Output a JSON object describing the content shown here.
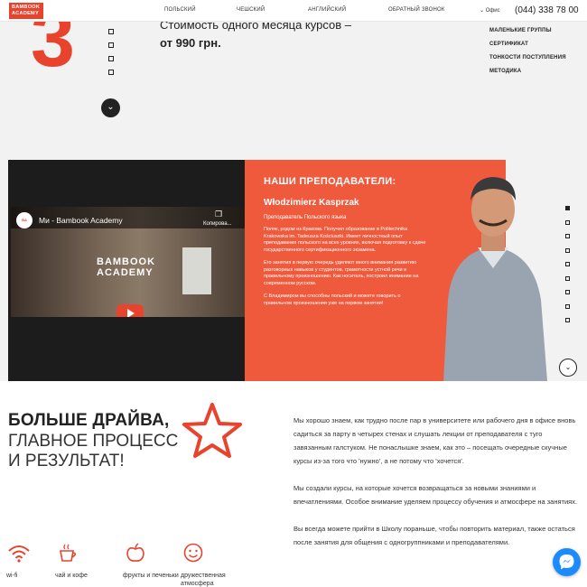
{
  "header": {
    "logo_text": "BAMBOOK ACADEMY",
    "nav": [
      "ПОЛЬСКИЙ",
      "ЧЕШСКИЙ",
      "АНГЛИЙСКИЙ",
      "ОБРАТНЫЙ ЗВОНОК"
    ],
    "office_label": "Офис",
    "phone": "(044) 338 78 00"
  },
  "hero": {
    "number": "3",
    "price_line1": "Стоимость одного месяца курсов –",
    "price_line2": "от 990 грн."
  },
  "side_menu": [
    "МАЛЕНЬКИЕ ГРУППЫ",
    "СЕРТИФИКАТ",
    "ТОНКОСТИ ПОСТУПЛЕНИЯ",
    "МЕТОДИКА"
  ],
  "video": {
    "title": "Ми - Bambook Academy",
    "copy_label": "Копирова...",
    "logo_line1": "BAMBOOK",
    "logo_line2": "ACADEMY"
  },
  "teachers": {
    "heading": "НАШИ ПРЕПОДАВАТЕЛИ:",
    "name": "Włodzimierz Kasprzak",
    "role": "Преподаватель Польского языка",
    "paragraphs": [
      "Поляк, родом из Кракова. Получил образование в Politechnika Krakowska im. Tadeusza Kościuszki. Имеет личностный опыт преподавания польского на всех уровнях, включая подготовку к сдаче государственного сертификационного экзамена.",
      "Его занятия в первую очередь уделяют много внимания развитию разговорных навыков у студентов, грамотности устной речи и правильному произношению. Как носитель, построил внимание на современном русском.",
      "С Владимиром вы способны польский и можете говорить о правильном произношении уже на первом занятии!"
    ]
  },
  "drive": {
    "heading_bold": "БОЛЬШЕ ДРАЙВА,",
    "heading_light": "ГЛАВНОЕ ПРОЦЕСС И РЕЗУЛЬТАТ!",
    "paragraphs": [
      "Мы хорошо знаем, как трудно после пар в университете или рабочего дня в офисе вновь садиться за парту в четырех стенах и слушать лекции от преподавателя с туго завязанным галстуком. Не понаслышке знаем, как это – посещать очередные скучные курсы из-за того что 'нужно', а не потому что 'хочется'.",
      "Мы создали курсы, на которые хочется возвращаться за новыми знаниями и впечатлениями. Особое внимание уделяем процессу обучения и атмосфере на занятиях.",
      "Вы всегда можете прийти в Школу пораньше, чтобы повторить материал, также остаться после занятия для общения с одногруппниками и преподавателями."
    ],
    "features": [
      {
        "icon": "wifi-icon",
        "label": "wi-fi"
      },
      {
        "icon": "coffee-cup-icon",
        "label": "чай и кофе"
      },
      {
        "icon": "apple-icon",
        "label": "фрукты и печеньки"
      },
      {
        "icon": "smiley-icon",
        "label": "дружественная атмосфера"
      }
    ]
  },
  "colors": {
    "accent": "#e8432d",
    "panel": "#f05a3c",
    "messenger": "#1a8cff"
  }
}
